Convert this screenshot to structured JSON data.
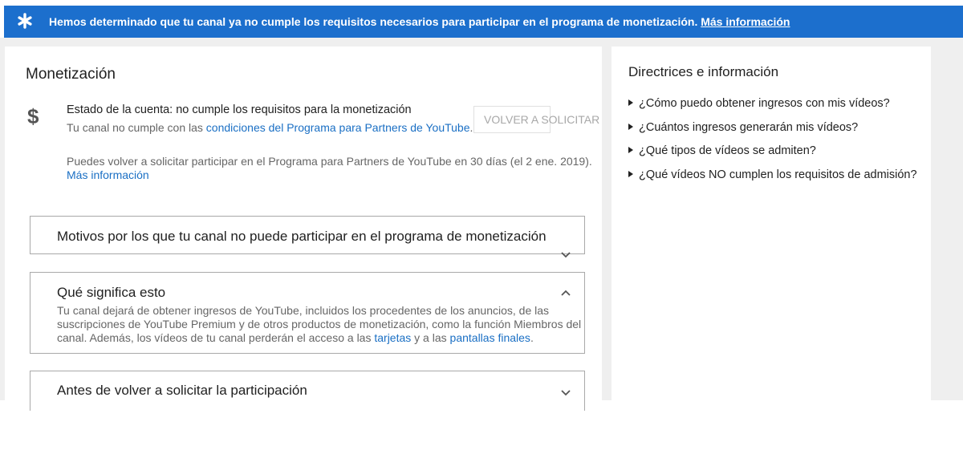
{
  "banner": {
    "message": "Hemos determinado que tu canal ya no cumple los requisitos necesarios para participar en el programa de monetización.",
    "link": "Más información"
  },
  "monetization": {
    "title": "Monetización",
    "currency_symbol": "$",
    "status": "Estado de la cuenta: no cumple los requisitos para la monetización",
    "status_sub_prefix": "Tu canal no cumple con las ",
    "status_sub_link": "condiciones del Programa para Partners de YouTube",
    "status_sub_suffix": ".",
    "reapply_button": "VOLVER A SOLICITAR",
    "reapply_note": "Puedes volver a solicitar participar en el Programa para Partners de YouTube en 30 días (el 2 ene. 2019).",
    "reapply_link": "Más información"
  },
  "sections": {
    "reasons": {
      "title": "Motivos por los que tu canal no puede participar en el programa de monetización"
    },
    "meaning": {
      "title": "Qué significa esto",
      "body_prefix": "Tu canal dejará de obtener ingresos de YouTube, incluidos los procedentes de los anuncios, de las suscripciones de YouTube Premium y de otros productos de monetización, como la función Miembros del canal. Además, los vídeos de tu canal perderán el acceso a las ",
      "body_link1": "tarjetas",
      "body_mid": " y a las ",
      "body_link2": "pantallas finales",
      "body_suffix": "."
    },
    "before": {
      "title": "Antes de volver a solicitar la participación"
    }
  },
  "guidelines": {
    "title": "Directrices e información",
    "items": [
      "¿Cómo puedo obtener ingresos con mis vídeos?",
      "¿Cuántos ingresos generarán mis vídeos?",
      "¿Qué tipos de vídeos se admiten?",
      "¿Qué vídeos NO cumplen los requisitos de admisión?"
    ]
  },
  "colors": {
    "banner": "#1c6fcd",
    "link": "#1a6fc4"
  },
  "icons": {
    "banner": "asterisk-icon",
    "status": "dollar-icon",
    "expand": "chevron-down-icon",
    "collapse": "chevron-up-icon",
    "list": "triangle-right-icon"
  }
}
